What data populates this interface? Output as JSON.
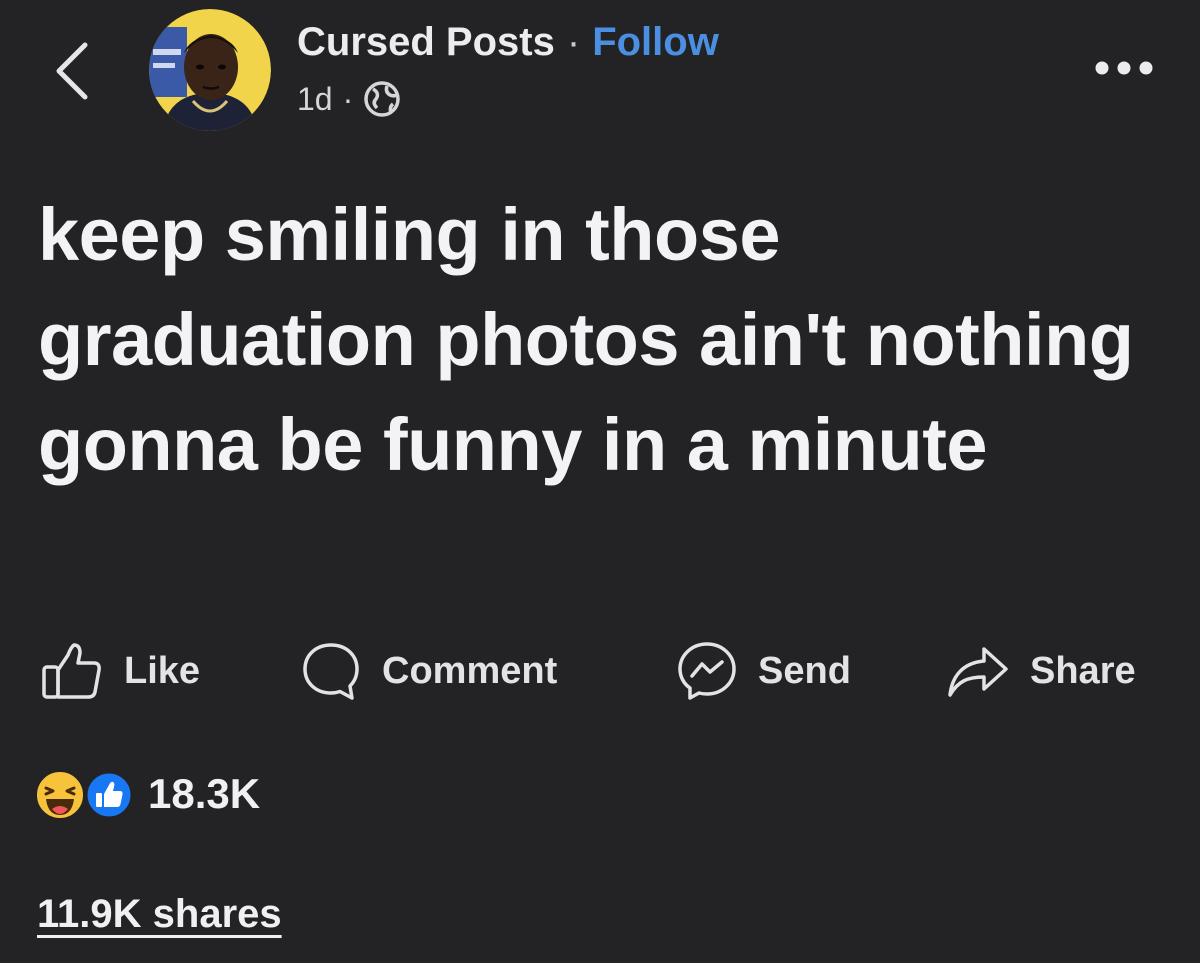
{
  "header": {
    "back_icon": "chevron-left-icon",
    "author_name": "Cursed Posts",
    "separator": "·",
    "follow_label": "Follow",
    "time_ago": "1d",
    "meta_separator": "·",
    "audience_icon": "globe-icon",
    "more_icon": "more-horizontal-icon"
  },
  "post": {
    "text": "keep smiling in those graduation photos ain't nothing gonna be funny in a minute"
  },
  "actions": {
    "like_label": "Like",
    "like_icon": "thumbs-up-outline-icon",
    "comment_label": "Comment",
    "comment_icon": "comment-bubble-icon",
    "send_label": "Send",
    "send_icon": "messenger-icon",
    "share_label": "Share",
    "share_icon": "share-arrow-icon"
  },
  "stats": {
    "reaction_icons": [
      "haha-reaction-icon",
      "like-reaction-icon"
    ],
    "reaction_count": "18.3K",
    "shares_text": "11.9K shares"
  },
  "colors": {
    "background": "#232325",
    "text_primary": "#f3f3f5",
    "follow_blue": "#4b8fe2",
    "like_badge_blue": "#1877f2",
    "haha_yellow": "#f7c33a"
  }
}
